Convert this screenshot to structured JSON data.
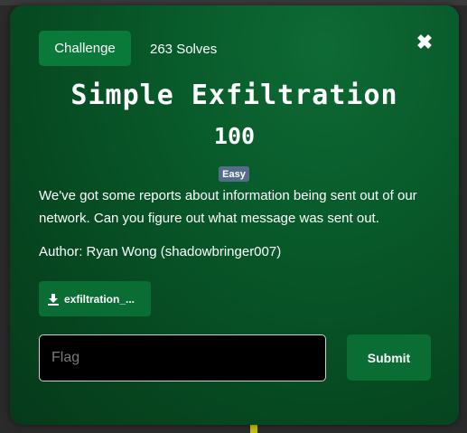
{
  "modal": {
    "tab_label": "Challenge",
    "solves": "263 Solves",
    "close_glyph": "✖",
    "title": "Simple Exfiltration",
    "points": "100",
    "difficulty": "Easy",
    "description": "We've got some reports about information being sent out of our network. Can you figure out what message was sent out.",
    "author": "Author: Ryan Wong (shadowbringer007)",
    "file_label": "exfiltration_...",
    "file_icon": "download-icon",
    "flag_placeholder": "Flag",
    "flag_value": "",
    "submit_label": "Submit"
  },
  "colors": {
    "modal_bg": "#06451f",
    "button_green": "#0a6e34",
    "badge": "#566d8a",
    "input_bg": "#000000"
  }
}
